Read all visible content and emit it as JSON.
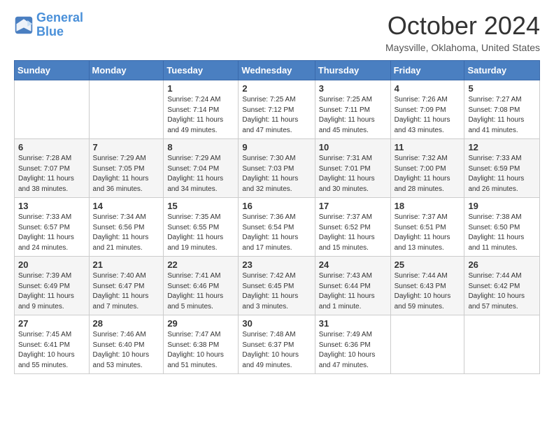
{
  "header": {
    "logo_line1": "General",
    "logo_line2": "Blue",
    "month": "October 2024",
    "location": "Maysville, Oklahoma, United States"
  },
  "days_of_week": [
    "Sunday",
    "Monday",
    "Tuesday",
    "Wednesday",
    "Thursday",
    "Friday",
    "Saturday"
  ],
  "weeks": [
    [
      {
        "day": "",
        "sunrise": "",
        "sunset": "",
        "daylight": ""
      },
      {
        "day": "",
        "sunrise": "",
        "sunset": "",
        "daylight": ""
      },
      {
        "day": "1",
        "sunrise": "Sunrise: 7:24 AM",
        "sunset": "Sunset: 7:14 PM",
        "daylight": "Daylight: 11 hours and 49 minutes."
      },
      {
        "day": "2",
        "sunrise": "Sunrise: 7:25 AM",
        "sunset": "Sunset: 7:12 PM",
        "daylight": "Daylight: 11 hours and 47 minutes."
      },
      {
        "day": "3",
        "sunrise": "Sunrise: 7:25 AM",
        "sunset": "Sunset: 7:11 PM",
        "daylight": "Daylight: 11 hours and 45 minutes."
      },
      {
        "day": "4",
        "sunrise": "Sunrise: 7:26 AM",
        "sunset": "Sunset: 7:09 PM",
        "daylight": "Daylight: 11 hours and 43 minutes."
      },
      {
        "day": "5",
        "sunrise": "Sunrise: 7:27 AM",
        "sunset": "Sunset: 7:08 PM",
        "daylight": "Daylight: 11 hours and 41 minutes."
      }
    ],
    [
      {
        "day": "6",
        "sunrise": "Sunrise: 7:28 AM",
        "sunset": "Sunset: 7:07 PM",
        "daylight": "Daylight: 11 hours and 38 minutes."
      },
      {
        "day": "7",
        "sunrise": "Sunrise: 7:29 AM",
        "sunset": "Sunset: 7:05 PM",
        "daylight": "Daylight: 11 hours and 36 minutes."
      },
      {
        "day": "8",
        "sunrise": "Sunrise: 7:29 AM",
        "sunset": "Sunset: 7:04 PM",
        "daylight": "Daylight: 11 hours and 34 minutes."
      },
      {
        "day": "9",
        "sunrise": "Sunrise: 7:30 AM",
        "sunset": "Sunset: 7:03 PM",
        "daylight": "Daylight: 11 hours and 32 minutes."
      },
      {
        "day": "10",
        "sunrise": "Sunrise: 7:31 AM",
        "sunset": "Sunset: 7:01 PM",
        "daylight": "Daylight: 11 hours and 30 minutes."
      },
      {
        "day": "11",
        "sunrise": "Sunrise: 7:32 AM",
        "sunset": "Sunset: 7:00 PM",
        "daylight": "Daylight: 11 hours and 28 minutes."
      },
      {
        "day": "12",
        "sunrise": "Sunrise: 7:33 AM",
        "sunset": "Sunset: 6:59 PM",
        "daylight": "Daylight: 11 hours and 26 minutes."
      }
    ],
    [
      {
        "day": "13",
        "sunrise": "Sunrise: 7:33 AM",
        "sunset": "Sunset: 6:57 PM",
        "daylight": "Daylight: 11 hours and 24 minutes."
      },
      {
        "day": "14",
        "sunrise": "Sunrise: 7:34 AM",
        "sunset": "Sunset: 6:56 PM",
        "daylight": "Daylight: 11 hours and 21 minutes."
      },
      {
        "day": "15",
        "sunrise": "Sunrise: 7:35 AM",
        "sunset": "Sunset: 6:55 PM",
        "daylight": "Daylight: 11 hours and 19 minutes."
      },
      {
        "day": "16",
        "sunrise": "Sunrise: 7:36 AM",
        "sunset": "Sunset: 6:54 PM",
        "daylight": "Daylight: 11 hours and 17 minutes."
      },
      {
        "day": "17",
        "sunrise": "Sunrise: 7:37 AM",
        "sunset": "Sunset: 6:52 PM",
        "daylight": "Daylight: 11 hours and 15 minutes."
      },
      {
        "day": "18",
        "sunrise": "Sunrise: 7:37 AM",
        "sunset": "Sunset: 6:51 PM",
        "daylight": "Daylight: 11 hours and 13 minutes."
      },
      {
        "day": "19",
        "sunrise": "Sunrise: 7:38 AM",
        "sunset": "Sunset: 6:50 PM",
        "daylight": "Daylight: 11 hours and 11 minutes."
      }
    ],
    [
      {
        "day": "20",
        "sunrise": "Sunrise: 7:39 AM",
        "sunset": "Sunset: 6:49 PM",
        "daylight": "Daylight: 11 hours and 9 minutes."
      },
      {
        "day": "21",
        "sunrise": "Sunrise: 7:40 AM",
        "sunset": "Sunset: 6:47 PM",
        "daylight": "Daylight: 11 hours and 7 minutes."
      },
      {
        "day": "22",
        "sunrise": "Sunrise: 7:41 AM",
        "sunset": "Sunset: 6:46 PM",
        "daylight": "Daylight: 11 hours and 5 minutes."
      },
      {
        "day": "23",
        "sunrise": "Sunrise: 7:42 AM",
        "sunset": "Sunset: 6:45 PM",
        "daylight": "Daylight: 11 hours and 3 minutes."
      },
      {
        "day": "24",
        "sunrise": "Sunrise: 7:43 AM",
        "sunset": "Sunset: 6:44 PM",
        "daylight": "Daylight: 11 hours and 1 minute."
      },
      {
        "day": "25",
        "sunrise": "Sunrise: 7:44 AM",
        "sunset": "Sunset: 6:43 PM",
        "daylight": "Daylight: 10 hours and 59 minutes."
      },
      {
        "day": "26",
        "sunrise": "Sunrise: 7:44 AM",
        "sunset": "Sunset: 6:42 PM",
        "daylight": "Daylight: 10 hours and 57 minutes."
      }
    ],
    [
      {
        "day": "27",
        "sunrise": "Sunrise: 7:45 AM",
        "sunset": "Sunset: 6:41 PM",
        "daylight": "Daylight: 10 hours and 55 minutes."
      },
      {
        "day": "28",
        "sunrise": "Sunrise: 7:46 AM",
        "sunset": "Sunset: 6:40 PM",
        "daylight": "Daylight: 10 hours and 53 minutes."
      },
      {
        "day": "29",
        "sunrise": "Sunrise: 7:47 AM",
        "sunset": "Sunset: 6:38 PM",
        "daylight": "Daylight: 10 hours and 51 minutes."
      },
      {
        "day": "30",
        "sunrise": "Sunrise: 7:48 AM",
        "sunset": "Sunset: 6:37 PM",
        "daylight": "Daylight: 10 hours and 49 minutes."
      },
      {
        "day": "31",
        "sunrise": "Sunrise: 7:49 AM",
        "sunset": "Sunset: 6:36 PM",
        "daylight": "Daylight: 10 hours and 47 minutes."
      },
      {
        "day": "",
        "sunrise": "",
        "sunset": "",
        "daylight": ""
      },
      {
        "day": "",
        "sunrise": "",
        "sunset": "",
        "daylight": ""
      }
    ]
  ]
}
